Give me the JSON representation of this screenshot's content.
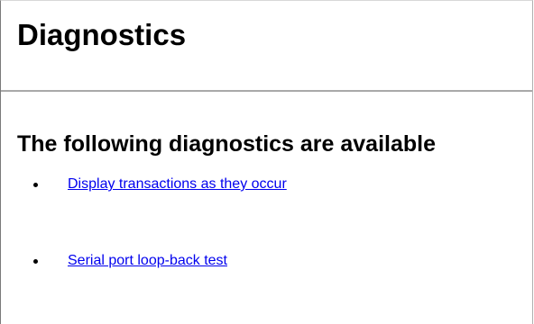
{
  "header": {
    "title": "Diagnostics"
  },
  "main": {
    "section_title": "The following diagnostics are available",
    "items": [
      {
        "label": "Display transactions as they occur"
      },
      {
        "label": "Serial port loop-back test"
      }
    ]
  },
  "colors": {
    "link": "#0000ee",
    "divider": "#a9a9a9",
    "background": "#ffffff"
  }
}
